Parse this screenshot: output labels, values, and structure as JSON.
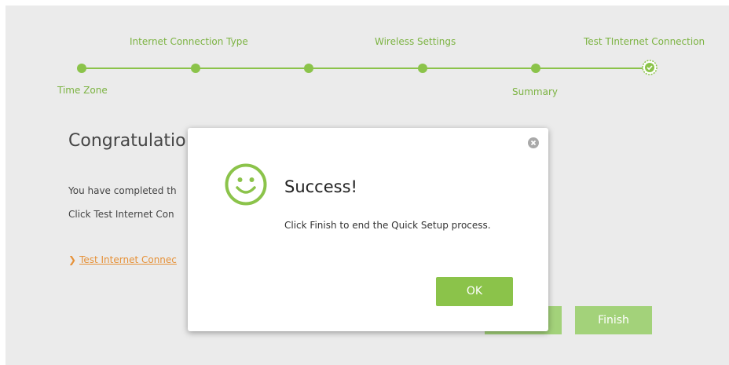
{
  "steps": {
    "time_zone": "Time Zone",
    "internet_connection_type": "Internet Connection Type",
    "wireless_settings": "Wireless Settings",
    "summary": "Summary",
    "test_connection": "Test TInternet Connection"
  },
  "main": {
    "title": "Congratulatio",
    "line1": "You have completed th",
    "line2": "Click Test Internet Con",
    "test_link": "Test Internet Connec",
    "finish_label": "Finish"
  },
  "modal": {
    "title": "Success!",
    "message": "Click Finish to end the Quick Setup process.",
    "ok_label": "OK"
  },
  "colors": {
    "accent": "#8bc34a",
    "link": "#e69138"
  }
}
